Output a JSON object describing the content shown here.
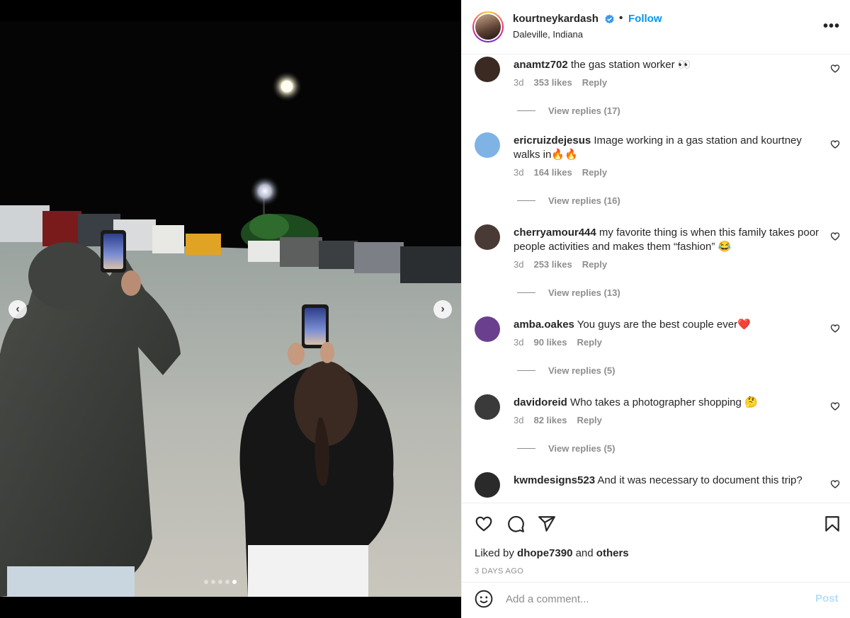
{
  "post": {
    "author": "kourtneykardash",
    "separator": "•",
    "follow_label": "Follow",
    "location": "Daleville, Indiana",
    "more_label": "•••"
  },
  "media": {
    "prev_label": "‹",
    "next_label": "›",
    "slide_count": 5,
    "active_slide": 5
  },
  "comments": [
    {
      "user": "anamtz702",
      "text": "the gas station worker 👀",
      "age": "3d",
      "likes": "353 likes",
      "reply_label": "Reply",
      "view_replies": "View replies (17)",
      "avatar_color": "#3a2a22"
    },
    {
      "user": "ericruizdejesus",
      "text": "Image working in a gas station and kourtney walks in🔥🔥",
      "age": "3d",
      "likes": "164 likes",
      "reply_label": "Reply",
      "view_replies": "View replies (16)",
      "avatar_color": "#7fb3e6"
    },
    {
      "user": "cherryamour444",
      "text": "my favorite thing is when this family takes poor people activities and makes them “fashion” 😂",
      "age": "3d",
      "likes": "253 likes",
      "reply_label": "Reply",
      "view_replies": "View replies (13)",
      "avatar_color": "#4a3a36"
    },
    {
      "user": "amba.oakes",
      "text": "You guys are the best couple ever❤️",
      "age": "3d",
      "likes": "90 likes",
      "reply_label": "Reply",
      "view_replies": "View replies (5)",
      "avatar_color": "#6a3f8e"
    },
    {
      "user": "davidoreid",
      "text": "Who takes a photographer shopping 🤔",
      "age": "3d",
      "likes": "82 likes",
      "reply_label": "Reply",
      "view_replies": "View replies (5)",
      "avatar_color": "#3a3a3a"
    },
    {
      "user": "kwmdesigns523",
      "text": "And it was necessary to document this trip?",
      "age": "",
      "likes": "",
      "reply_label": "",
      "view_replies": "",
      "avatar_color": "#2a2a2a"
    }
  ],
  "footer": {
    "liked_by_prefix": "Liked by",
    "liked_by_user": "dhope7390",
    "liked_by_and": "and",
    "liked_by_others": "others",
    "date": "3 DAYS AGO",
    "comment_placeholder": "Add a comment...",
    "post_label": "Post"
  },
  "colors": {
    "link_blue": "#0095f6",
    "post_disabled": "#b2dffc",
    "muted": "#8e8e8e",
    "text": "#262626"
  },
  "icons": [
    "verified-badge-icon",
    "more-icon",
    "heart-icon",
    "comment-icon",
    "share-icon",
    "bookmark-icon",
    "emoji-icon",
    "chevron-left-icon",
    "chevron-right-icon"
  ]
}
